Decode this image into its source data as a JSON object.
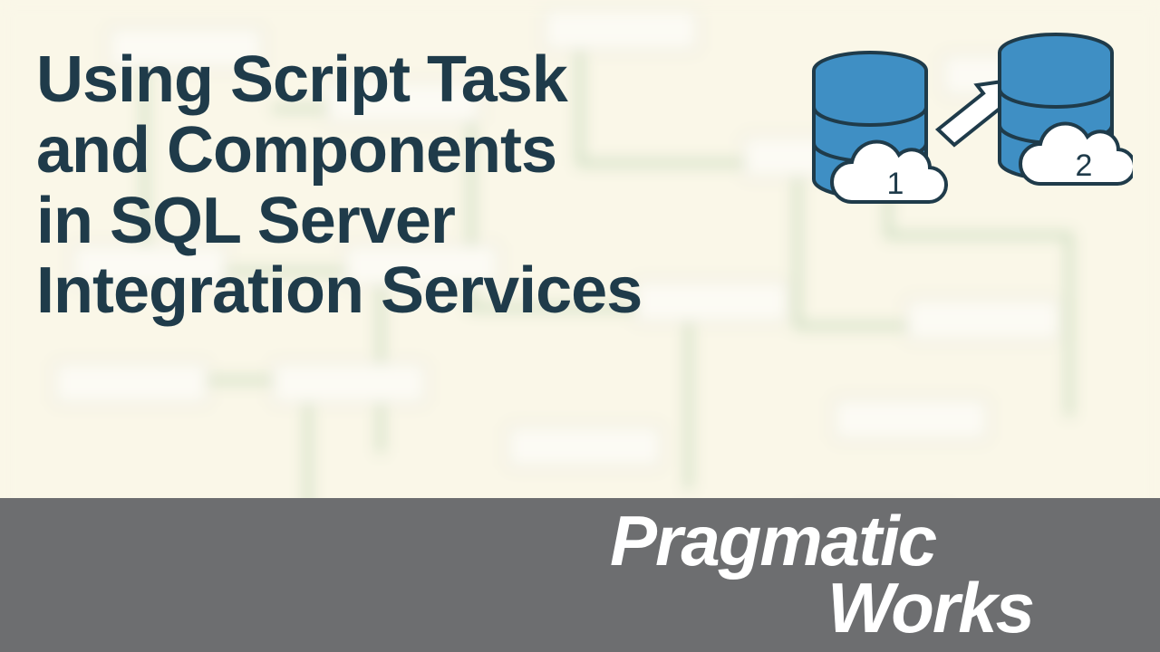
{
  "title": {
    "line1": "Using Script Task",
    "line2": "and Components",
    "line3": "in SQL Server",
    "line4": "Integration Services"
  },
  "brand": {
    "line1": "Pragmatic",
    "line2": "Works"
  },
  "illustration": {
    "db1_label": "1",
    "db2_label": "2"
  },
  "colors": {
    "title": "#1f3b4a",
    "background": "#faf7e8",
    "footer": "#6d6e70",
    "brand_text": "#ffffff",
    "db_fill": "#3f8fc4",
    "db_stroke": "#1f3b4a"
  }
}
